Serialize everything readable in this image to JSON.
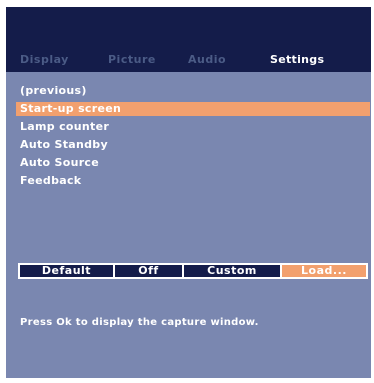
{
  "colors": {
    "panel_background": "#7a87b0",
    "top_band": "#141c4a",
    "inactive_tab_text": "#4b5b86",
    "highlight": "#f2a06e",
    "option_background": "#141c4a",
    "text": "#ffffff"
  },
  "tabs": [
    {
      "label": "Display",
      "active": false
    },
    {
      "label": "Picture",
      "active": false
    },
    {
      "label": "Audio",
      "active": false
    },
    {
      "label": "Settings",
      "active": true
    }
  ],
  "menu": {
    "items": [
      {
        "label": "(previous)",
        "selected": false
      },
      {
        "label": "Start-up screen",
        "selected": true
      },
      {
        "label": "Lamp counter",
        "selected": false
      },
      {
        "label": "Auto Standby",
        "selected": false
      },
      {
        "label": "Auto Source",
        "selected": false
      },
      {
        "label": "Feedback",
        "selected": false
      }
    ]
  },
  "options": {
    "items": [
      {
        "label": "Default",
        "active": false
      },
      {
        "label": "Off",
        "active": false
      },
      {
        "label": "Custom",
        "active": false
      },
      {
        "label": "Load...",
        "active": true
      }
    ]
  },
  "hint": "Press Ok to display the capture window."
}
